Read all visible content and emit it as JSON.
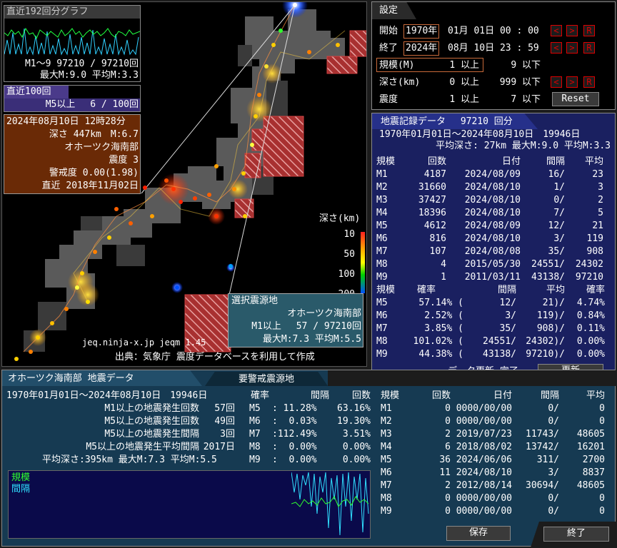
{
  "graph192": {
    "title": "直近192回分グラフ",
    "line1": "M1～9 97210 / 97210回",
    "line2": "最大M:9.0 平均M:3.3"
  },
  "recent100": {
    "title": "直近100回",
    "line": "M5以上　 6 / 100回"
  },
  "latest": {
    "line1": "2024年08月10日 12時28分",
    "line2": "深さ 447km　M:6.7",
    "line3": "オホーツク海南部",
    "line4": "震度 3",
    "line5": "警戒度 0.00(1.98)",
    "line6": "直近 2018年11月02日"
  },
  "map": {
    "depth_title": "深さ(km)",
    "depth_ticks": [
      "10",
      "50",
      "100",
      "200"
    ],
    "credit": "jeq.ninja-x.jp jeqm 1.45",
    "source": "出典：気象庁 震度データベースを利用して作成",
    "colors": {
      "shallow": "#ff2020",
      "mid": "#ffd000",
      "deep": "#00a0ff",
      "hatch": "#b03030"
    }
  },
  "selected": {
    "title": "選択震源地",
    "name": "オホーツク海南部",
    "line1": "M1以上　 57 / 97210回",
    "line2": "最大M:7.3 平均M:5.5"
  },
  "settings": {
    "title": "設定",
    "start_label": "開始",
    "start_year": "1970年",
    "start_rest": "01月 01日 00 : 00",
    "end_label": "終了",
    "end_year": "2024年",
    "end_rest": "08月 10日 23 : 59",
    "scale_label": "規模(M)",
    "scale_min": "1 以上",
    "scale_max": "9 以下",
    "depth_label": "深さ(km)",
    "depth_min": "0 以上",
    "depth_max": "999 以下",
    "intensity_label": "震度",
    "intensity_min": "1 以上",
    "intensity_max": "7 以下",
    "reset": "Reset",
    "prev": "<",
    "next": ">",
    "r": "R"
  },
  "records": {
    "title": "地震記録データ　 97210 回分",
    "range": "1970年01月01日～2024年08月10日　19946日",
    "avg": "平均深さ: 27km 最大M:9.0 平均M:3.3",
    "head1": [
      "規模",
      "回数",
      "日付",
      "間隔",
      "平均"
    ],
    "rows1": [
      [
        "M1",
        "4187",
        "2024/08/09",
        "16/",
        "23"
      ],
      [
        "M2",
        "31660",
        "2024/08/10",
        "1/",
        "3"
      ],
      [
        "M3",
        "37427",
        "2024/08/10",
        "0/",
        "2"
      ],
      [
        "M4",
        "18396",
        "2024/08/10",
        "7/",
        "5"
      ],
      [
        "M5",
        "4612",
        "2024/08/09",
        "12/",
        "21"
      ],
      [
        "M6",
        "816",
        "2024/08/10",
        "3/",
        "119"
      ],
      [
        "M7",
        "107",
        "2024/08/08",
        "35/",
        "908"
      ],
      [
        "M8",
        "4",
        "2015/05/30",
        "24551/",
        "24302"
      ],
      [
        "M9",
        "1",
        "2011/03/11",
        "43138/",
        "97210"
      ]
    ],
    "head2": [
      "規模",
      "確率",
      "間隔",
      "平均",
      "確率"
    ],
    "rows2": [
      [
        "M5",
        "57.14% (",
        "12/",
        "21)/",
        "4.74%"
      ],
      [
        "M6",
        "2.52% (",
        "3/",
        "119)/",
        "0.84%"
      ],
      [
        "M7",
        "3.85% (",
        "35/",
        "908)/",
        "0.11%"
      ],
      [
        "M8",
        "101.02% (",
        "24551/",
        "24302)/",
        "0.00%"
      ],
      [
        "M9",
        "44.38% (",
        "43138/",
        "97210)/",
        "0.00%"
      ]
    ],
    "status": "データ更新 完了",
    "update": "更新"
  },
  "region": {
    "tab": "オホーツク海南部 地震データ",
    "tab2": "要警戒震源地",
    "range": "1970年01月01日～2024年08月10日　19946日",
    "stats": [
      [
        "M1以上の地震発生回数",
        "57回"
      ],
      [
        "M5以上の地震発生回数",
        "49回"
      ],
      [
        "M5以上の地震発生間隔",
        "3回"
      ],
      [
        "M5以上の地震発生平均間隔",
        "2017日"
      ]
    ],
    "avg": "平均深さ:395km 最大M:7.3 平均M:5.5",
    "prob_head": [
      "確率",
      "間隔",
      "回数"
    ],
    "prob_rows": [
      [
        "M5",
        ": 11.28%",
        "63.16%"
      ],
      [
        "M6",
        ":  0.03%",
        "19.30%"
      ],
      [
        "M7",
        ":112.49%",
        " 3.51%"
      ],
      [
        "M8",
        ":  0.00%",
        " 0.00%"
      ],
      [
        "M9",
        ":  0.00%",
        " 0.00%"
      ]
    ],
    "legend_scale": "規模",
    "legend_interval": "間隔",
    "head": [
      "規模",
      "回数",
      "日付",
      "間隔",
      "平均"
    ],
    "rows": [
      [
        "M1",
        "0",
        "0000/00/00",
        "0/",
        "0"
      ],
      [
        "M2",
        "0",
        "0000/00/00",
        "0/",
        "0"
      ],
      [
        "M3",
        "2",
        "2019/07/23",
        "11743/",
        "48605"
      ],
      [
        "M4",
        "6",
        "2018/08/02",
        "13742/",
        "16201"
      ],
      [
        "M5",
        "36",
        "2024/06/06",
        "311/",
        "2700"
      ],
      [
        "M6",
        "11",
        "2024/08/10",
        "3/",
        "8837"
      ],
      [
        "M7",
        "2",
        "2012/08/14",
        "30694/",
        "48605"
      ],
      [
        "M8",
        "0",
        "0000/00/00",
        "0/",
        "0"
      ],
      [
        "M9",
        "0",
        "0000/00/00",
        "0/",
        "0"
      ]
    ],
    "save": "保存",
    "exit": "終了"
  }
}
